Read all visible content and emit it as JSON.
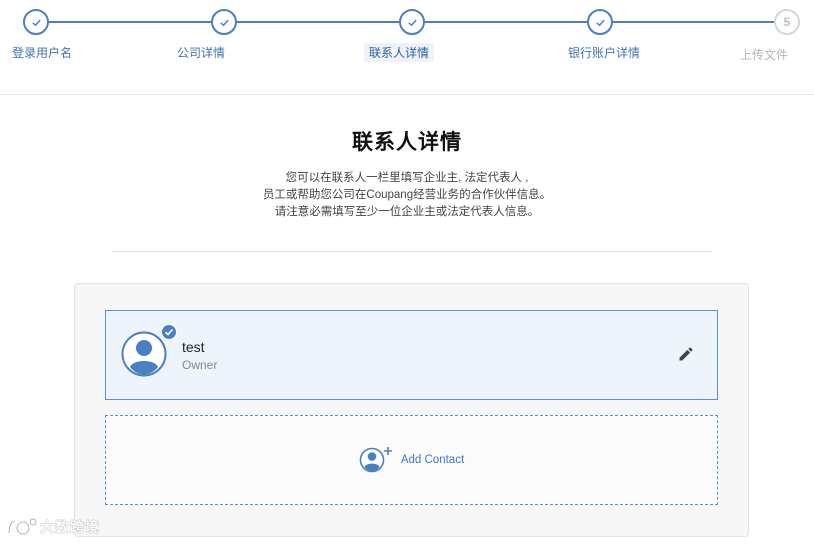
{
  "stepper": {
    "steps": [
      {
        "label": "登录用户名",
        "state": "done",
        "icon": "check-icon"
      },
      {
        "label": "公司详情",
        "state": "done",
        "icon": "check-icon"
      },
      {
        "label": "联系人详情",
        "state": "active",
        "icon": "check-icon"
      },
      {
        "label": "银行账户详情",
        "state": "done",
        "icon": "check-icon"
      },
      {
        "label": "上传文件",
        "state": "pending",
        "number": "5"
      }
    ]
  },
  "header": {
    "title": "联系人详情",
    "description": [
      "您可以在联系人一栏里填写企业主, 法定代表人 ,",
      "员工或帮助您公司在Coupang经营业务的合作伙伴信息。",
      "请注意必需填写至少一位企业主或法定代表人信息。"
    ]
  },
  "contacts": [
    {
      "name": "test",
      "role": "Owner",
      "avatar_icon": "user-avatar-icon",
      "verified_icon": "verified-check-icon",
      "edit_icon": "pencil-icon"
    }
  ],
  "add_contact": {
    "label": "Add Contact",
    "icon": "add-user-icon"
  },
  "watermark": {
    "text": "大数跨境"
  },
  "colors": {
    "accent": "#4a7fc1",
    "pending": "#d6d6d6",
    "card_bg": "#eef4fc",
    "link": "#3c78c6"
  }
}
